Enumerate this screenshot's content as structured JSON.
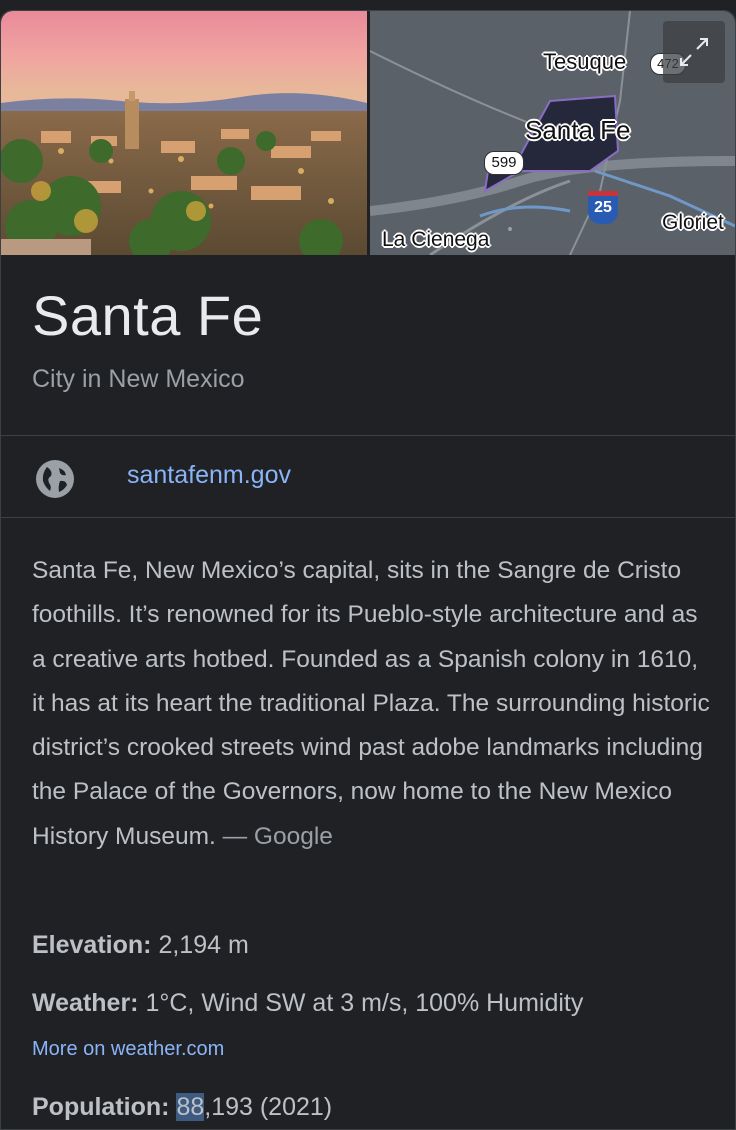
{
  "map": {
    "labels": {
      "tesuque": "Tesuque",
      "santa_fe": "Santa Fe",
      "la_cienega": "La Cienega",
      "glorieta": "Gloriet",
      "route_599": "599",
      "interstate_25": "25",
      "route_472": "472"
    }
  },
  "entity": {
    "title": "Santa Fe",
    "subtitle": "City in New Mexico"
  },
  "website": {
    "label": "santafenm.gov"
  },
  "description": {
    "text": "Santa Fe, New Mexico’s capital, sits in the Sangre de Cristo foothills. It’s renowned for its Pueblo-style architecture and as a creative arts hotbed. Founded as a Spanish colony in 1610, it has at its heart the traditional Plaza. The surrounding historic district’s crooked streets wind past adobe landmarks including the Palace of the Governors, now home to the New Mexico History Museum.",
    "source": "— Google"
  },
  "facts": {
    "elevation": {
      "label": "Elevation:",
      "value": "2,194 m"
    },
    "weather": {
      "label": "Weather:",
      "value": "1°C, Wind SW at 3 m/s, 100% Humidity"
    },
    "weather_link": "More on weather.com",
    "population": {
      "label": "Population:",
      "value_highlight": "88",
      "value_rest": ",193 (2021)"
    }
  },
  "colors": {
    "background": "#202124",
    "link": "#8ab4f8",
    "text": "#bdc1c6",
    "muted": "#9aa0a6",
    "highlight": "#3d5a80"
  }
}
